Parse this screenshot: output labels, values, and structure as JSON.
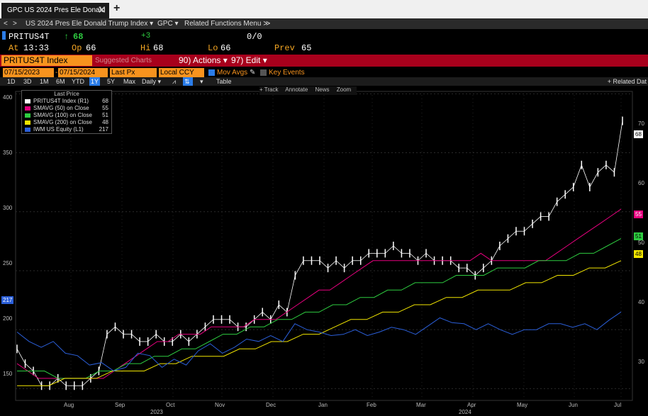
{
  "tab": {
    "label": "GPC US 2024 Pres Ele Donald",
    "close": "✕",
    "add": "+"
  },
  "nav": {
    "back": "<",
    "fwd": ">",
    "crumb": "US 2024 Pres Ele Donald Trump Index ▾",
    "func": "GPC ▾",
    "related": "Related Functions Menu ≫"
  },
  "quote": {
    "ticker": "PRITUS4T",
    "arrow": "↑",
    "last": "68",
    "change": "+3",
    "size": "0/0",
    "at_label": "At",
    "at_value": "13:33",
    "op_label": "Op",
    "op_value": "66",
    "hi_label": "Hi",
    "hi_value": "68",
    "lo_label": "Lo",
    "lo_value": "66",
    "prev_label": "Prev",
    "prev_value": "65"
  },
  "toolbar": {
    "security": "PRITUS4T Index",
    "suggested": "Suggested Charts",
    "actions": "90) Actions ▾",
    "edit": "97) Edit ▾"
  },
  "params": {
    "start_date": "07/15/2023",
    "end_date": "07/15/2024",
    "price": "Last Px",
    "currency": "Local CCY",
    "mov_avgs": "Mov Avgs",
    "key_events": "Key Events"
  },
  "ranges": [
    "1D",
    "3D",
    "1M",
    "6M",
    "YTD",
    "1Y",
    "5Y",
    "Max"
  ],
  "range_selected": "1Y",
  "period": "Daily ▾",
  "table_label": "Table",
  "related_data": "+ Related Dat",
  "chart_tools": [
    "+ Track",
    "Annotate",
    "News",
    "Zoom"
  ],
  "legend": {
    "header": "Last Price",
    "items": [
      {
        "label": "PRITUS4T Index (R1)",
        "value": "68",
        "color": "#ffffff"
      },
      {
        "label": "SMAVG (50) on Close",
        "value": "55",
        "color": "#e6007e"
      },
      {
        "label": "SMAVG (100) on Close",
        "value": "51",
        "color": "#2ecc40"
      },
      {
        "label": "SMAVG (200) on Close",
        "value": "48",
        "color": "#f2e600"
      },
      {
        "label": "IWM US Equity (L1)",
        "value": "217",
        "color": "#2b5fd9"
      }
    ]
  },
  "chart_data": {
    "type": "line",
    "left_axis": {
      "ticks": [
        150,
        200,
        250,
        300,
        350,
        400
      ],
      "range": [
        140,
        402
      ]
    },
    "right_axis": {
      "ticks": [
        30,
        40,
        50,
        60,
        70
      ],
      "range": [
        29,
        71
      ]
    },
    "x_months": [
      "Aug",
      "Sep",
      "Oct",
      "Nov",
      "Dec",
      "Jan",
      "Feb",
      "Mar",
      "Apr",
      "May",
      "Jun",
      "Jul"
    ],
    "x_years": [
      "2023",
      "2024"
    ],
    "series": [
      {
        "name": "PRITUS4T Index (R1)",
        "axis": "right",
        "color": "#ffffff",
        "values": [
          36,
          34,
          33,
          31,
          31,
          32,
          31,
          31,
          31,
          32,
          33,
          38,
          39,
          38,
          38,
          37,
          37,
          38,
          37,
          37,
          38,
          37,
          38,
          39,
          40,
          40,
          40,
          39,
          39,
          40,
          41,
          40,
          42,
          41,
          46,
          48,
          48,
          48,
          47,
          48,
          47,
          48,
          48,
          49,
          49,
          49,
          50,
          49,
          49,
          48,
          49,
          48,
          48,
          48,
          47,
          47,
          46,
          47,
          48,
          50,
          51,
          52,
          52,
          53,
          54,
          54,
          56,
          57,
          58,
          61,
          58,
          60,
          61,
          60,
          67
        ]
      },
      {
        "name": "SMAVG (50) on Close",
        "axis": "right",
        "color": "#e6007e",
        "values": [
          34,
          33,
          32,
          32,
          32,
          32,
          32,
          32,
          32,
          33,
          34,
          35,
          36,
          37,
          37,
          38,
          38,
          38,
          39,
          39,
          39,
          39,
          40,
          40,
          40,
          41,
          42,
          43,
          44,
          44,
          45,
          46,
          47,
          48,
          48,
          48,
          48,
          48,
          48,
          48,
          48,
          48,
          48,
          49,
          48,
          48,
          48,
          48,
          48,
          48,
          49,
          50,
          51,
          52,
          53,
          54,
          55
        ]
      },
      {
        "name": "SMAVG (100) on Close",
        "axis": "right",
        "color": "#2ecc40",
        "values": [
          33,
          33,
          33,
          32,
          32,
          32,
          33,
          33,
          34,
          34,
          35,
          35,
          36,
          36,
          37,
          38,
          38,
          39,
          39,
          40,
          40,
          41,
          41,
          42,
          42,
          43,
          43,
          44,
          44,
          45,
          45,
          45,
          46,
          46,
          46,
          47,
          47,
          47,
          48,
          48,
          48,
          49,
          49,
          50,
          51
        ]
      },
      {
        "name": "SMAVG (200) on Close",
        "axis": "right",
        "color": "#f2e600",
        "values": [
          31,
          31,
          31,
          32,
          32,
          32,
          33,
          33,
          33,
          34,
          34,
          35,
          35,
          35,
          36,
          36,
          37,
          37,
          38,
          38,
          39,
          40,
          40,
          41,
          41,
          42,
          42,
          43,
          43,
          44,
          44,
          44,
          45,
          45,
          46,
          46,
          47,
          47,
          48
        ]
      },
      {
        "name": "IWM US Equity (L1)",
        "axis": "left",
        "color": "#2b5fd9",
        "values": [
          198,
          190,
          185,
          190,
          180,
          178,
          170,
          172,
          165,
          168,
          180,
          178,
          168,
          175,
          170,
          182,
          188,
          180,
          185,
          192,
          190,
          195,
          190,
          205,
          200,
          198,
          195,
          196,
          200,
          195,
          198,
          202,
          200,
          196,
          203,
          210,
          206,
          205,
          200,
          205,
          200,
          196,
          200,
          200,
          205,
          205,
          202,
          205,
          200,
          208,
          215
        ]
      }
    ],
    "current_values": {
      "left": "217",
      "right_price": "68",
      "sma50": "55",
      "sma100": "51",
      "sma200": "48"
    }
  }
}
